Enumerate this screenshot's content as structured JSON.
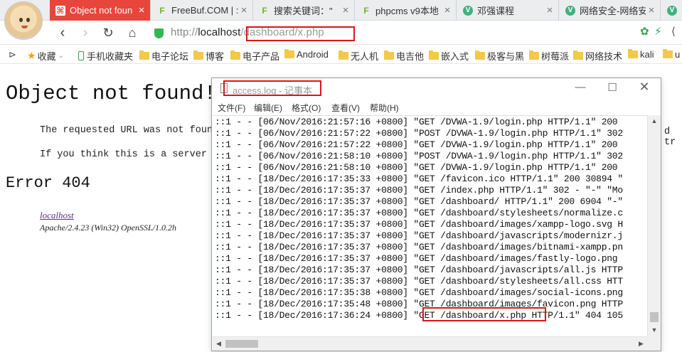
{
  "tabs": [
    {
      "title": "Object not foun",
      "icon": "xampp-icon",
      "icon_color": "#e8453c",
      "active": true
    },
    {
      "title": "FreeBuf.COM | :",
      "icon": "freebuf-icon",
      "icon_color": "#74b327",
      "active": false
    },
    {
      "title": "搜索关键词：\"",
      "icon": "freebuf-icon",
      "icon_color": "#74b327",
      "active": false
    },
    {
      "title": "phpcms v9本地",
      "icon": "freebuf-icon",
      "icon_color": "#74b327",
      "active": false
    },
    {
      "title": "邓强课程",
      "icon": "vue-icon",
      "icon_color": "#3fb27f",
      "active": false
    },
    {
      "title": "网络安全-网络安",
      "icon": "vue-icon",
      "icon_color": "#3fb27f",
      "active": false
    }
  ],
  "address": {
    "prefix": "http://",
    "host": "localhost",
    "path": "/dashboard/x.php"
  },
  "bookmarks": [
    {
      "label": "收藏",
      "type": "star"
    },
    {
      "label": "手机收藏夹",
      "type": "phone"
    },
    {
      "label": "电子论坛",
      "type": "folder"
    },
    {
      "label": "博客",
      "type": "folder"
    },
    {
      "label": "电子产品",
      "type": "folder"
    },
    {
      "label": "Android",
      "type": "folder"
    },
    {
      "label": "无人机",
      "type": "folder"
    },
    {
      "label": "电吉他",
      "type": "folder"
    },
    {
      "label": "嵌入式",
      "type": "folder"
    },
    {
      "label": "极客与黑",
      "type": "folder"
    },
    {
      "label": "树莓派",
      "type": "folder"
    },
    {
      "label": "网络技术",
      "type": "folder"
    },
    {
      "label": "kali",
      "type": "folder"
    },
    {
      "label": "u",
      "type": "folder"
    }
  ],
  "page": {
    "title": "Object not found!",
    "p1": "The requested URL was not foun",
    "p1_end": "d tr",
    "p2": "If you think this is a server",
    "error": "Error 404",
    "link": "localhost",
    "signature": "Apache/2.4.23 (Win32) OpenSSL/1.0.2h"
  },
  "notepad": {
    "title": "access.log - 记事本",
    "menu": [
      "文件(F)",
      "编辑(E)",
      "格式(O)",
      "查看(V)",
      "帮助(H)"
    ],
    "lines": [
      "::1 - - [06/Nov/2016:21:57:16 +0800] \"GET /DVWA-1.9/login.php HTTP/1.1\" 200",
      "::1 - - [06/Nov/2016:21:57:22 +0800] \"POST /DVWA-1.9/login.php HTTP/1.1\" 302",
      "::1 - - [06/Nov/2016:21:57:22 +0800] \"GET /DVWA-1.9/login.php HTTP/1.1\" 200",
      "::1 - - [06/Nov/2016:21:58:10 +0800] \"POST /DVWA-1.9/login.php HTTP/1.1\" 302",
      "::1 - - [06/Nov/2016:21:58:10 +0800] \"GET /DVWA-1.9/login.php HTTP/1.1\" 200",
      "::1 - - [18/Dec/2016:17:35:33 +0800] \"GET /favicon.ico HTTP/1.1\" 200 30894 \"",
      "::1 - - [18/Dec/2016:17:35:37 +0800] \"GET /index.php HTTP/1.1\" 302 - \"-\" \"Mo",
      "::1 - - [18/Dec/2016:17:35:37 +0800] \"GET /dashboard/ HTTP/1.1\" 200 6904 \"-\"",
      "::1 - - [18/Dec/2016:17:35:37 +0800] \"GET /dashboard/stylesheets/normalize.c",
      "::1 - - [18/Dec/2016:17:35:37 +0800] \"GET /dashboard/images/xampp-logo.svg H",
      "::1 - - [18/Dec/2016:17:35:37 +0800] \"GET /dashboard/javascripts/modernizr.j",
      "::1 - - [18/Dec/2016:17:35:37 +0800] \"GET /dashboard/images/bitnami-xampp.pn",
      "::1 - - [18/Dec/2016:17:35:37 +0800] \"GET /dashboard/images/fastly-logo.png",
      "::1 - - [18/Dec/2016:17:35:37 +0800] \"GET /dashboard/javascripts/all.js HTTP",
      "::1 - - [18/Dec/2016:17:35:37 +0800] \"GET /dashboard/stylesheets/all.css HTT",
      "::1 - - [18/Dec/2016:17:35:38 +0800] \"GET /dashboard/images/social-icons.png",
      "::1 - - [18/Dec/2016:17:35:48 +0800] \"GET /dashboard/images/favicon.png HTTP",
      "::1 - - [18/Dec/2016:17:36:24 +0800] \"GET /dashboard/x.php HTTP/1.1\" 404 105"
    ]
  },
  "colors": {
    "highlight": "#d8161b",
    "active_tab": "#e8453c"
  }
}
